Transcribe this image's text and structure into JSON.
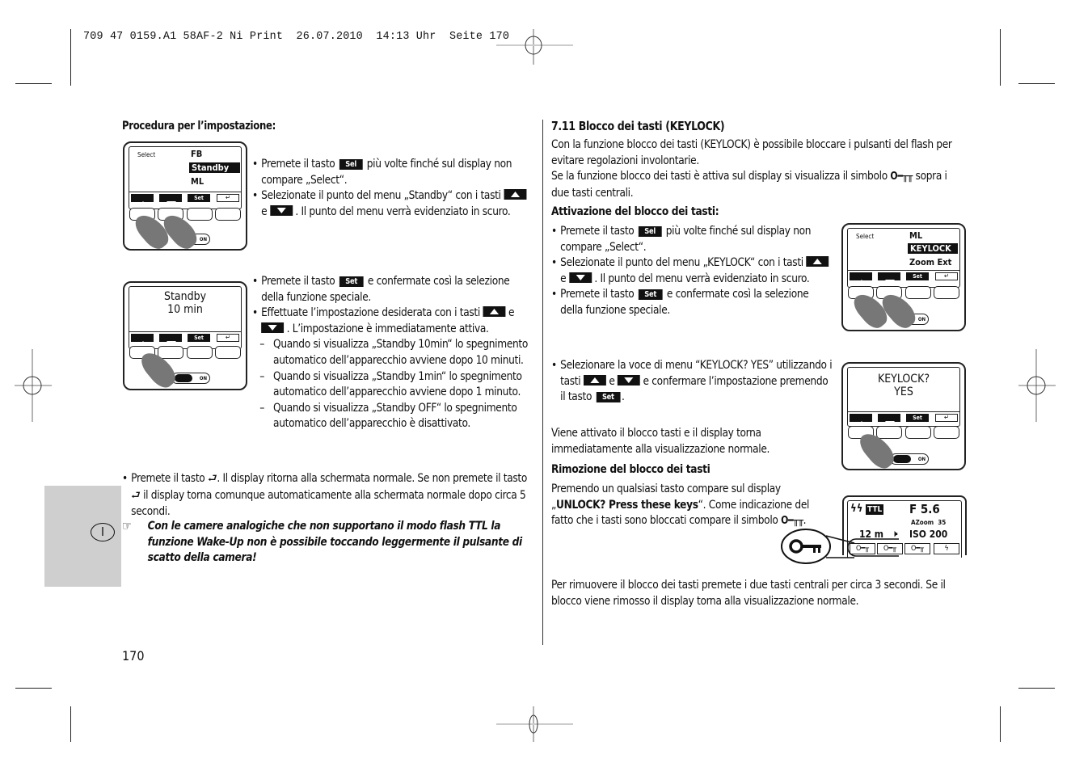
{
  "print_header": "709 47 0159.A1 58AF-2 Ni Print  26.07.2010  14:13 Uhr  Seite 170",
  "page_number": "170",
  "language_tab": "I",
  "left": {
    "heading": "Procedura per l’impostazione:",
    "display1": {
      "label": "Select",
      "items": [
        "FB",
        "Standby",
        "ML"
      ],
      "selected": "Standby",
      "softkeys": [
        "▲",
        "▼",
        "Set",
        "↵"
      ]
    },
    "bullets1": [
      {
        "pre": "Premete il tasto ",
        "key": "Sel",
        "post": " più volte finché sul display non compare „Select“."
      },
      {
        "pre": "Selezionate il punto del menu „Standby“ con i tasti ",
        "mid": " e ",
        "post": " . Il punto del menu verrà evidenziato in scuro."
      }
    ],
    "display2": {
      "line1": "Standby",
      "line2": "10 min",
      "softkeys": [
        "▲",
        "▼",
        "Set",
        "↵"
      ],
      "switch_label": "ON"
    },
    "bullets2": [
      {
        "pre": "Premete il tasto ",
        "key": "Set",
        "post": " e confermate così la selezione della funzione speciale."
      },
      {
        "pre": "Effettuate l’impostazione desiderata con i tasti ",
        "mid": " e ",
        "post": " . L’impostazione è immediatamente attiva."
      }
    ],
    "dashes": [
      "Quando si visualizza „Standby 10min“ lo spegnimento automatico dell’apparecchio avviene dopo 10 minuti.",
      "Quando si visualizza „Standby 1min“ lo spegnimento automatico dell’apparecchio avviene dopo 1 minuto.",
      "Quando si visualizza „Standby OFF“ lo spegnimento automatico dell’apparecchio è disattivato."
    ],
    "bullet3": {
      "pre": "Premete il tasto ",
      "mid": ". Il display ritorna alla schermata normale. Se non premete il tasto ",
      "post": " il display torna comunque automaticamente alla schermata normale dopo circa 5 secondi."
    },
    "note": "Con le camere analogiche che non supportano il modo flash TTL la funzione Wake-Up non è possibile toccando leggermente il pulsante di scatto della camera!"
  },
  "right": {
    "heading": "7.11 Blocco dei tasti (KEYLOCK)",
    "intro1": "Con la funzione blocco dei tasti (KEYLOCK) è possibile bloccare i pulsanti del flash per evitare regolazioni involontarie.",
    "intro2_pre": "Se la funzione blocco dei tasti è attiva sul display si visualizza il simbolo ",
    "intro2_post": " sopra i due tasti centrali.",
    "sub1": "Attivazione del blocco dei tasti:",
    "bullets": [
      {
        "pre": "Premete il tasto ",
        "key": "Sel",
        "post": " più volte finché sul display non compare „Select“."
      },
      {
        "pre": "Selezionate il punto del menu „KEYLOCK“ con i tasti ",
        "mid": " e ",
        "post": " . Il punto del menu verrà evidenziato in scuro."
      },
      {
        "pre": "Premete il tasto ",
        "key": "Set",
        "post": " e confermate così la selezione della funzione speciale."
      }
    ],
    "display3": {
      "label": "Select",
      "items": [
        "ML",
        "KEYLOCK",
        "Zoom Ext"
      ],
      "selected": "KEYLOCK",
      "softkeys": [
        "▲",
        "▼",
        "Set",
        "↵"
      ]
    },
    "bullet4": {
      "pre": "Selezionare la voce di menu “KEYLOCK? YES” utilizzando i tasti ",
      "mid": " e ",
      "mid2": " e confermare l’impostazione premendo il tasto ",
      "key": "Set",
      "post": "."
    },
    "display4": {
      "line1": "KEYLOCK?",
      "line2": "YES",
      "softkeys": [
        "▲",
        "▼",
        "Set",
        "↵"
      ],
      "switch_label": "ON"
    },
    "para_activated": "Viene attivato il blocco tasti e il display  torna immediatamente alla visualizzazione normale.",
    "sub2": "Rimozione del blocco dei tasti",
    "unlock_pre": "Premendo un qualsiasi tasto compare sul display „",
    "unlock_bold": "UNLOCK? Press these keys",
    "unlock_post": "“. Come indicazione del fatto che i tasti sono bloccati compare il simbolo ",
    "display5": {
      "mode": "TTL",
      "aperture": "F 5.6",
      "zoom": "AZoom  35",
      "distance": "12 m",
      "iso": "ISO 200"
    },
    "final": "Per rimuovere il blocco dei tasti premete i due tasti centrali per circa 3 secondi. Se il blocco viene rimosso il display torna alla visualizzazione normale."
  }
}
